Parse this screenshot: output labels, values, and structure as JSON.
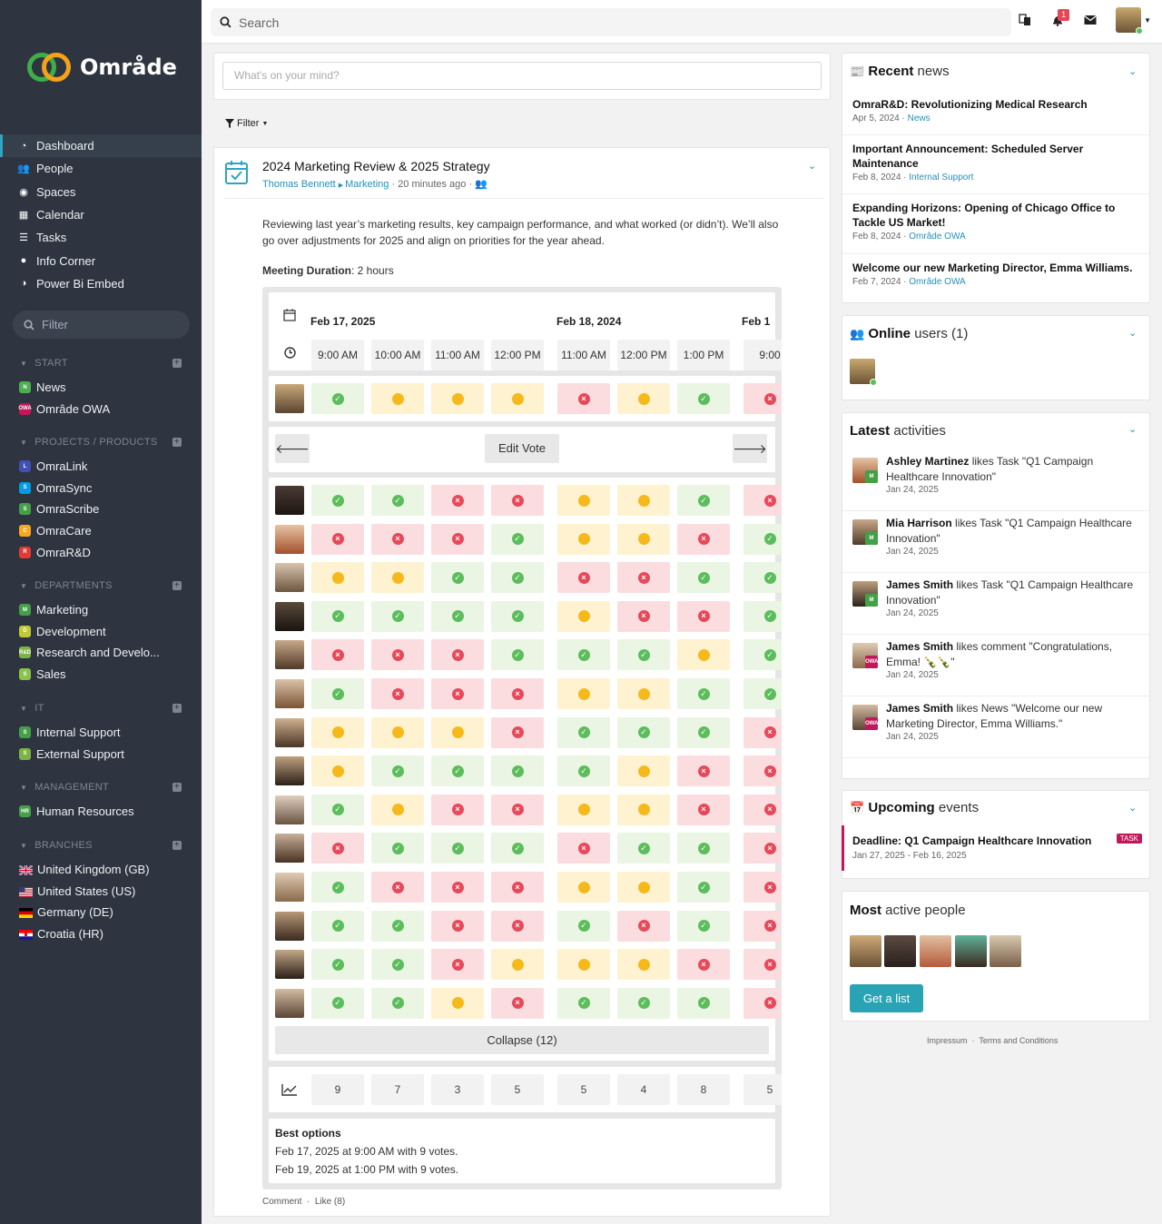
{
  "brand": {
    "name": "Område"
  },
  "topbar": {
    "search_placeholder": "Search",
    "notification_count": "1"
  },
  "sidebar": {
    "main": [
      {
        "label": "Dashboard",
        "icon": "dashboard-icon"
      },
      {
        "label": "People",
        "icon": "people-icon"
      },
      {
        "label": "Spaces",
        "icon": "spaces-icon"
      },
      {
        "label": "Calendar",
        "icon": "calendar-icon"
      },
      {
        "label": "Tasks",
        "icon": "tasks-icon"
      },
      {
        "label": "Info Corner",
        "icon": "info-icon"
      },
      {
        "label": "Power Bi Embed",
        "icon": "contrast-icon"
      }
    ],
    "filter_placeholder": "Filter",
    "sections": [
      {
        "title": "START",
        "items": [
          {
            "label": "News",
            "color": "#4caf50",
            "abbr": "N"
          },
          {
            "label": "Omrâde OWA",
            "color": "#c2185b",
            "abbr": "OWA"
          }
        ]
      },
      {
        "title": "PROJECTS / PRODUCTS",
        "items": [
          {
            "label": "OmraLink",
            "color": "#3f51b5",
            "abbr": "L"
          },
          {
            "label": "OmraSync",
            "color": "#039be5",
            "abbr": "S"
          },
          {
            "label": "OmraScribe",
            "color": "#43a047",
            "abbr": "S"
          },
          {
            "label": "OmraCare",
            "color": "#f9a825",
            "abbr": "C"
          },
          {
            "label": "OmraR&D",
            "color": "#e53935",
            "abbr": "R"
          }
        ]
      },
      {
        "title": "DEPARTMENTS",
        "items": [
          {
            "label": "Marketing",
            "color": "#43a047",
            "abbr": "M"
          },
          {
            "label": "Development",
            "color": "#c0ca33",
            "abbr": "D"
          },
          {
            "label": "Research and Develo...",
            "color": "#7cb342",
            "abbr": "R&D"
          },
          {
            "label": "Sales",
            "color": "#8bc34a",
            "abbr": "S"
          }
        ]
      },
      {
        "title": "IT",
        "items": [
          {
            "label": "Internal Support",
            "color": "#43a047",
            "abbr": "S"
          },
          {
            "label": "External Support",
            "color": "#7cb342",
            "abbr": "S"
          }
        ]
      },
      {
        "title": "MANAGEMENT",
        "items": [
          {
            "label": "Human Resources",
            "color": "#43a047",
            "abbr": "HR"
          }
        ]
      },
      {
        "title": "BRANCHES",
        "items": [
          {
            "label": "United Kingdom (GB)",
            "flag": "gb"
          },
          {
            "label": "United States (US)",
            "flag": "us"
          },
          {
            "label": "Germany (DE)",
            "flag": "de"
          },
          {
            "label": "Croatia (HR)",
            "flag": "hr"
          }
        ]
      }
    ]
  },
  "feed": {
    "composer_placeholder": "What's on your mind?",
    "filter_label": "Filter",
    "post": {
      "title": "2024 Marketing Review & 2025 Strategy",
      "author": "Thomas Bennett",
      "space": "Marketing",
      "time": "20 minutes ago",
      "description": "Reviewing last year’s marketing results, key campaign performance, and what worked (or didn’t). We’ll also go over adjustments for 2025 and align on priorities for the year ahead.",
      "duration_label": "Meeting Duration",
      "duration_value": ": 2 hours",
      "poll": {
        "date_groups": [
          {
            "label": "Feb 17, 2025"
          },
          {
            "label": "Feb 18, 2024"
          },
          {
            "label": "Feb 1"
          }
        ],
        "times": [
          "9:00 AM",
          "10:00 AM",
          "11:00 AM",
          "12:00 PM",
          "11:00 AM",
          "12:00 PM",
          "1:00 PM",
          "9:00"
        ],
        "my_vote": [
          "yes",
          "maybe",
          "maybe",
          "maybe",
          "no",
          "maybe",
          "yes",
          "no"
        ],
        "edit_vote_label": "Edit Vote",
        "votes": [
          [
            "yes",
            "yes",
            "no",
            "no",
            "maybe",
            "maybe",
            "yes",
            "no"
          ],
          [
            "no",
            "no",
            "no",
            "yes",
            "maybe",
            "maybe",
            "no",
            "yes"
          ],
          [
            "maybe",
            "maybe",
            "yes",
            "yes",
            "no",
            "no",
            "yes",
            "yes"
          ],
          [
            "yes",
            "yes",
            "yes",
            "yes",
            "maybe",
            "no",
            "no",
            "yes"
          ],
          [
            "no",
            "no",
            "no",
            "yes",
            "yes",
            "yes",
            "maybe",
            "yes"
          ],
          [
            "yes",
            "no",
            "no",
            "no",
            "maybe",
            "maybe",
            "yes",
            "yes"
          ],
          [
            "maybe",
            "maybe",
            "maybe",
            "no",
            "yes",
            "yes",
            "yes",
            "no"
          ],
          [
            "maybe",
            "yes",
            "yes",
            "yes",
            "yes",
            "maybe",
            "no",
            "no"
          ],
          [
            "yes",
            "maybe",
            "no",
            "no",
            "maybe",
            "maybe",
            "no",
            "no"
          ],
          [
            "no",
            "yes",
            "yes",
            "yes",
            "no",
            "yes",
            "yes",
            "no"
          ],
          [
            "yes",
            "no",
            "no",
            "no",
            "maybe",
            "maybe",
            "yes",
            "no"
          ],
          [
            "yes",
            "yes",
            "no",
            "no",
            "yes",
            "no",
            "yes",
            "no"
          ],
          [
            "yes",
            "yes",
            "no",
            "maybe",
            "maybe",
            "maybe",
            "no",
            "no"
          ],
          [
            "yes",
            "yes",
            "maybe",
            "no",
            "yes",
            "yes",
            "yes",
            "no"
          ]
        ],
        "collapse_label": "Collapse (12)",
        "counts": [
          "9",
          "7",
          "3",
          "5",
          "5",
          "4",
          "8",
          "5"
        ],
        "best_title": "Best options",
        "best_lines": [
          "Feb 17, 2025 at 9:00 AM with 9 votes.",
          "Feb 19, 2025 at 1:00 PM with 9 votes."
        ]
      },
      "actions": {
        "comment": "Comment",
        "like": "Like (8)"
      }
    }
  },
  "recent_news": {
    "title_bold": "Recent",
    "title_rest": " news",
    "items": [
      {
        "title": "OmraR&D: Revolutionizing Medical Research",
        "date": "Apr 5, 2024",
        "category": "News"
      },
      {
        "title": "Important Announcement: Scheduled Server Maintenance",
        "date": "Feb 8, 2024",
        "category": "Internal Support"
      },
      {
        "title": "Expanding Horizons: Opening of Chicago Office to Tackle US Market!",
        "date": "Feb 8, 2024",
        "category": "Omrâde OWA"
      },
      {
        "title": "Welcome our new Marketing Director, Emma Williams.",
        "date": "Feb 7, 2024",
        "category": "Omrâde OWA"
      }
    ]
  },
  "online_users": {
    "title_bold": "Online",
    "title_rest": " users (1)"
  },
  "latest_activities": {
    "title_bold": "Latest",
    "title_rest": " activities",
    "items": [
      {
        "name": "Ashley Martinez",
        "text": " likes Task \"Q1 Campaign Healthcare Innovation\"",
        "date": "Jan 24, 2025",
        "badge": "M",
        "badge_color": "#43a047"
      },
      {
        "name": "Mia Harrison",
        "text": " likes Task \"Q1 Campaign Healthcare Innovation\"",
        "date": "Jan 24, 2025",
        "badge": "M",
        "badge_color": "#43a047"
      },
      {
        "name": "James Smith",
        "text": " likes Task \"Q1 Campaign Healthcare Innovation\"",
        "date": "Jan 24, 2025",
        "badge": "M",
        "badge_color": "#43a047"
      },
      {
        "name": "James Smith",
        "text": " likes comment \"Congratulations, Emma! 🍾🍾\"",
        "date": "Jan 24, 2025",
        "badge": "OWA",
        "badge_color": "#c2185b"
      },
      {
        "name": "James Smith",
        "text": " likes News \"Welcome our new Marketing Director, Emma Williams.\"",
        "date": "Jan 24, 2025",
        "badge": "OWA",
        "badge_color": "#c2185b"
      }
    ]
  },
  "upcoming_events": {
    "title_bold": "Upcoming",
    "title_rest": " events",
    "items": [
      {
        "title": "Deadline: Q1 Campaign Healthcare Innovation",
        "dates": "Jan 27, 2025 - Feb 16, 2025",
        "tag": "TASK"
      }
    ]
  },
  "active_people": {
    "title_bold": "Most",
    "title_rest": " active people",
    "button": "Get a list"
  },
  "footer": {
    "impressum": "Impressum",
    "terms": "Terms and Conditions"
  },
  "colors": {
    "accent": "#2490b7",
    "sidebar_bg": "#2e3540",
    "yes": "#5cbd5c",
    "no": "#e64a5a",
    "maybe": "#f6b91c",
    "task_tag": "#c2185b"
  }
}
